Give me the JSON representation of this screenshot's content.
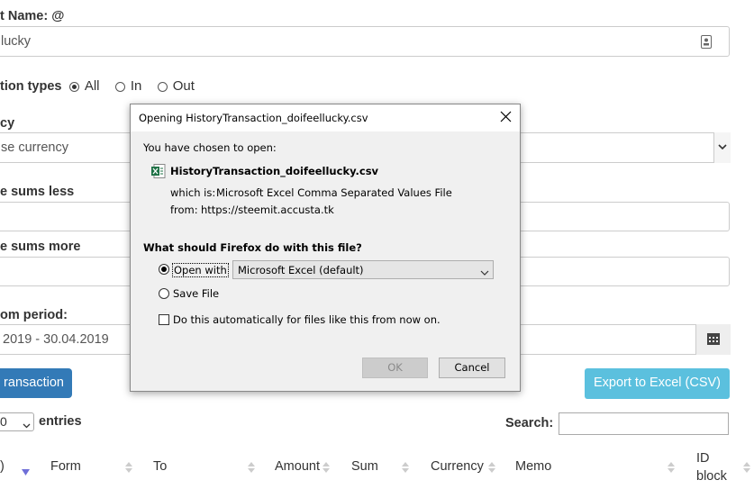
{
  "form": {
    "account_label": "t Name: @",
    "account_value": "lucky",
    "types_label": "tion types",
    "types_options": [
      "All",
      "In",
      "Out"
    ],
    "currency_label": "cy",
    "currency_placeholder": "se currency",
    "sums_less_label": "e sums less",
    "sums_more_label": "e sums more",
    "period_label": "om period:",
    "period_value": "2019 - 30.04.2019",
    "transaction_button": "ransaction",
    "export_button": "Export to Excel (CSV)"
  },
  "table": {
    "entries_value": "0",
    "entries_label": "entries",
    "search_label": "Search:",
    "columns": [
      ")",
      "Form",
      "To",
      "Amount",
      "Sum",
      "Currency",
      "Memo",
      "ID",
      "block"
    ]
  },
  "dialog": {
    "title": "Opening HistoryTransaction_doifeellucky.csv",
    "chosen_text": "You have chosen to open:",
    "filename": "HistoryTransaction_doifeellucky.csv",
    "which_is_label": "which is:",
    "which_is_value": "Microsoft Excel Comma Separated Values File",
    "from_label": "from:",
    "from_value": "https://steemit.accusta.tk",
    "question": "What should Firefox do with this file?",
    "open_with_label": "Open with",
    "open_with_app": "Microsoft Excel (default)",
    "save_file_label": "Save File",
    "auto_label": "Do this automatically for files like this from now on.",
    "ok_label": "OK",
    "cancel_label": "Cancel"
  },
  "colors": {
    "primary_button": "#337ab7",
    "info_button": "#5bc0de",
    "excel_green": "#1e7145"
  }
}
